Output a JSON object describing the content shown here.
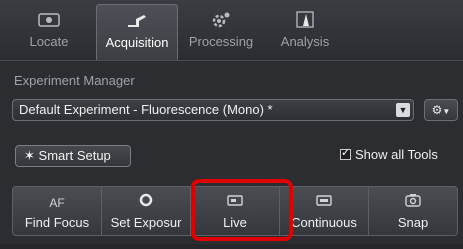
{
  "tabs": [
    {
      "label": "Locate",
      "icon": "locate-icon"
    },
    {
      "label": "Acquisition",
      "icon": "acquisition-icon"
    },
    {
      "label": "Processing",
      "icon": "processing-icon"
    },
    {
      "label": "Analysis",
      "icon": "analysis-icon"
    }
  ],
  "active_tab": "Acquisition",
  "experiment_manager": {
    "label": "Experiment Manager",
    "selected": "Default Experiment - Fluorescence (Mono) *"
  },
  "smart_setup": {
    "label": "Smart Setup"
  },
  "show_all_tools": {
    "label": "Show all Tools",
    "checked": true
  },
  "tools": [
    {
      "label": "Find Focus",
      "icon_text": "AF"
    },
    {
      "label": "Set Exposure",
      "icon_text": "",
      "visible_label": "Set Exposur"
    },
    {
      "label": "Live",
      "icon_text": ""
    },
    {
      "label": "Continuous",
      "icon_text": ""
    },
    {
      "label": "Snap",
      "icon_text": ""
    }
  ],
  "colors": {
    "highlight": "#e00000",
    "background": "#2b2d31"
  }
}
